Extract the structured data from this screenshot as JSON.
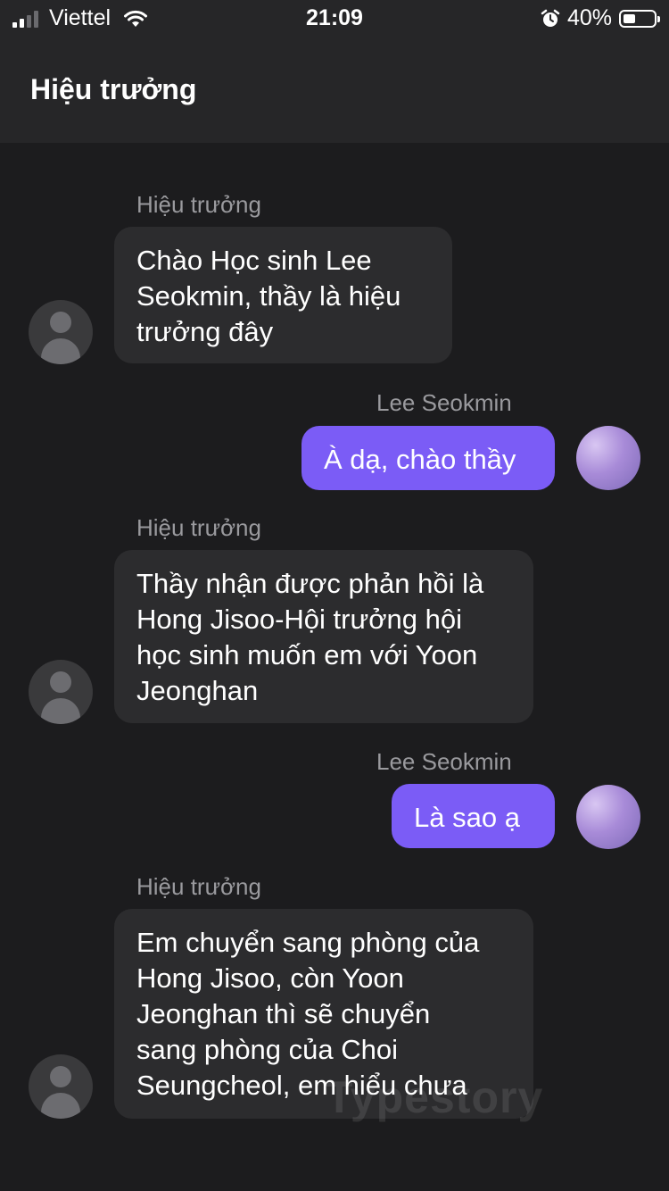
{
  "status_bar": {
    "carrier": "Viettel",
    "time": "21:09",
    "battery": "40%",
    "battery_level": 0.4
  },
  "header": {
    "title": "Hiệu trưởng"
  },
  "messages": [
    {
      "sender": "Hiệu trưởng",
      "text": "Chào Học sinh Lee\nSeokmin, thầy là hiệu\ntrưởng đây",
      "direction": "incoming"
    },
    {
      "sender": "Lee Seokmin",
      "text": "À dạ, chào thầy",
      "direction": "outgoing"
    },
    {
      "sender": "Hiệu trưởng",
      "text": "Thầy nhận được phản hồi là\nHong Jisoo-Hội trưởng hội\nhọc sinh muốn em với Yoon\nJeonghan",
      "direction": "incoming"
    },
    {
      "sender": "Lee Seokmin",
      "text": "Là sao ạ",
      "direction": "outgoing"
    },
    {
      "sender": "Hiệu trưởng",
      "text": "Em chuyển sang phòng của\nHong Jisoo, còn Yoon\nJeonghan thì sẽ chuyển\nsang phòng của Choi\nSeungcheol, em hiểu chưa",
      "direction": "incoming"
    }
  ],
  "watermark": "Typestory",
  "colors": {
    "outgoing_bubble": "#7b5cf6",
    "incoming_bubble": "#2c2c2e",
    "background": "#1c1c1e"
  }
}
